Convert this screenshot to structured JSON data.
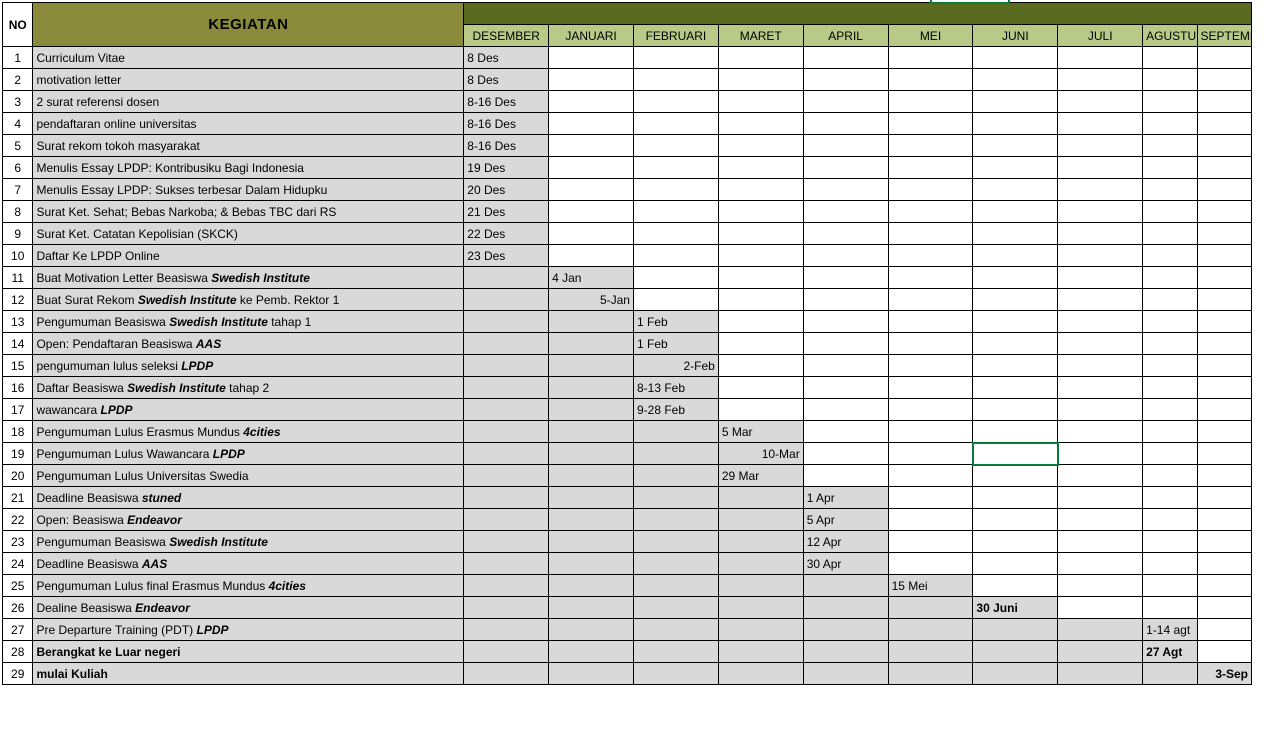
{
  "header": {
    "no": "NO",
    "kegiatan": "KEGIATAN",
    "months": [
      "DESEMBER",
      "JANUARI",
      "FEBRUARI",
      "MARET",
      "APRIL",
      "MEI",
      "JUNI",
      "JULI",
      "AGUSTUS",
      "SEPTEMBER"
    ]
  },
  "rows": [
    {
      "no": "1",
      "act": "Curriculum Vitae",
      "cells": {
        "0": "8 Des"
      }
    },
    {
      "no": "2",
      "act": "motivation letter",
      "cells": {
        "0": "8 Des"
      }
    },
    {
      "no": "3",
      "act": "2 surat referensi dosen",
      "cells": {
        "0": "8-16 Des"
      }
    },
    {
      "no": "4",
      "act": "pendaftaran online universitas",
      "cells": {
        "0": "8-16 Des"
      }
    },
    {
      "no": "5",
      "act": "Surat rekom tokoh masyarakat",
      "cells": {
        "0": "8-16 Des"
      }
    },
    {
      "no": "6",
      "act": "Menulis Essay LPDP: Kontribusiku Bagi Indonesia",
      "cells": {
        "0": "19 Des"
      }
    },
    {
      "no": "7",
      "act": "Menulis Essay LPDP: Sukses terbesar Dalam Hidupku",
      "cells": {
        "0": "20 Des"
      }
    },
    {
      "no": "8",
      "act": "Surat Ket. Sehat; Bebas Narkoba; & Bebas TBC dari RS",
      "cells": {
        "0": "21 Des"
      }
    },
    {
      "no": "9",
      "act": "Surat Ket. Catatan Kepolisian (SKCK)",
      "cells": {
        "0": "22 Des"
      }
    },
    {
      "no": "10",
      "act": "Daftar Ke LPDP Online",
      "cells": {
        "0": "23 Des"
      }
    },
    {
      "no": "11",
      "act_html": "Buat Motivation Letter Beasiswa <em class='bi'>Swedish Institute</em>",
      "shade_upto": 1,
      "cells": {
        "1": "4 Jan"
      }
    },
    {
      "no": "12",
      "act_html": "Buat Surat Rekom <em class='bi'>Swedish Institute</em>  ke Pemb. Rektor 1",
      "shade_upto": 1,
      "cells": {
        "1": "5-Jan"
      },
      "right": {
        "1": true
      }
    },
    {
      "no": "13",
      "act_html": "Pengumuman Beasiswa <em class='bi'>Swedish Institute</em>  tahap 1",
      "shade_upto": 2,
      "cells": {
        "2": "1 Feb"
      }
    },
    {
      "no": "14",
      "act_html": "Open: Pendaftaran Beasiswa <em class='bi'>AAS</em>",
      "shade_upto": 2,
      "cells": {
        "2": "1 Feb"
      }
    },
    {
      "no": "15",
      "act_html": "pengumuman lulus seleksi <em class='bi'>LPDP</em>",
      "shade_upto": 2,
      "cells": {
        "2": "2-Feb"
      },
      "right": {
        "2": true
      }
    },
    {
      "no": "16",
      "act_html": "Daftar Beasiswa <em class='bi'>Swedish Institute</em>  tahap 2",
      "shade_upto": 2,
      "cells": {
        "2": "8-13 Feb"
      }
    },
    {
      "no": "17",
      "act_html": "wawancara <em class='bi'>LPDP</em>",
      "shade_upto": 2,
      "cells": {
        "2": "9-28 Feb"
      }
    },
    {
      "no": "18",
      "act_html": "Pengumuman Lulus Erasmus Mundus <em class='bi'>4cities</em>",
      "shade_upto": 3,
      "cells": {
        "3": "5 Mar"
      }
    },
    {
      "no": "19",
      "act_html": "Pengumuman Lulus Wawancara <em class='bi'>LPDP</em>",
      "shade_upto": 3,
      "cells": {
        "3": "10-Mar"
      },
      "right": {
        "3": true
      }
    },
    {
      "no": "20",
      "act": "Pengumuman Lulus Universitas Swedia",
      "shade_upto": 3,
      "cells": {
        "3": "29 Mar"
      }
    },
    {
      "no": "21",
      "act_html": "Deadline Beasiswa <em class='bi'>stuned</em>",
      "shade_upto": 4,
      "cells": {
        "4": "1 Apr"
      }
    },
    {
      "no": "22",
      "act_html": "Open: Beasiswa <em class='bi'>Endeavor</em>",
      "shade_upto": 4,
      "cells": {
        "4": "5 Apr"
      }
    },
    {
      "no": "23",
      "act_html": "Pengumuman Beasiswa <em class='bi'>Swedish Institute</em>",
      "shade_upto": 4,
      "cells": {
        "4": "12 Apr"
      }
    },
    {
      "no": "24",
      "act_html": "Deadline Beasiswa <em class='bi'>AAS</em>",
      "shade_upto": 4,
      "cells": {
        "4": "30 Apr"
      }
    },
    {
      "no": "25",
      "act_html": "Pengumuman Lulus final Erasmus Mundus <em class='bi'>4cities</em>",
      "shade_upto": 5,
      "cells": {
        "5": "15 Mei"
      }
    },
    {
      "no": "26",
      "act_html": "Dealine Beasiswa <em class='bi'>Endeavor</em>",
      "shade_upto": 6,
      "cells": {
        "6": "30 Juni"
      },
      "bold": {
        "6": true
      }
    },
    {
      "no": "27",
      "act_html": "Pre Departure Training (PDT) <em class='bi'>LPDP</em>",
      "shade_upto": 8,
      "cells": {
        "8": "1-14 agt"
      }
    },
    {
      "no": "28",
      "act": "Berangkat ke Luar negeri",
      "bold_act": true,
      "shade_upto": 8,
      "cells": {
        "8": "27 Agt"
      },
      "bold": {
        "8": true
      }
    },
    {
      "no": "29",
      "act": "mulai Kuliah",
      "bold_act": true,
      "shade_upto": 9,
      "cells": {
        "9": "3-Sep"
      },
      "bold": {
        "9": true
      },
      "right": {
        "9": true
      }
    }
  ],
  "selected_cell": {
    "row": "19",
    "col": 6
  }
}
